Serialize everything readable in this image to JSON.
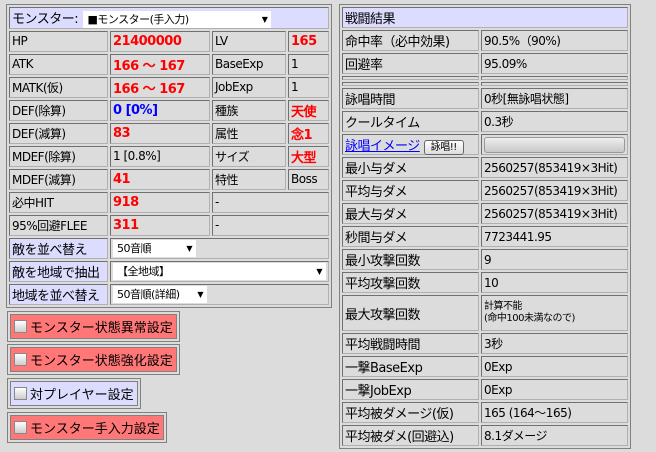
{
  "monster": {
    "label": "モンスター:",
    "selected": "■モンスター(手入力)"
  },
  "stats": [
    {
      "l1": "HP",
      "v1": "21400000",
      "c1": "red",
      "l2": "LV",
      "v2": "165",
      "c2": "red"
    },
    {
      "l1": "ATK",
      "v1": "166 ～ 167",
      "c1": "red",
      "l2": "BaseExp",
      "v2": "1",
      "c2": ""
    },
    {
      "l1": "MATK(仮)",
      "v1": "166 ～ 167",
      "c1": "red",
      "l2": "JobExp",
      "v2": "1",
      "c2": ""
    },
    {
      "l1": "DEF(除算)",
      "v1": "0 [0%]",
      "c1": "blue",
      "l2": "種族",
      "v2": "天使",
      "c2": "red"
    },
    {
      "l1": "DEF(減算)",
      "v1": "83",
      "c1": "red",
      "l2": "属性",
      "v2": "念1",
      "c2": "red"
    },
    {
      "l1": "MDEF(除算)",
      "v1": "1 [0.8%]",
      "c1": "",
      "l2": "サイズ",
      "v2": "大型",
      "c2": "red"
    },
    {
      "l1": "MDEF(減算)",
      "v1": "41",
      "c1": "red",
      "l2": "特性",
      "v2": "Boss",
      "c2": ""
    }
  ],
  "hit": {
    "label": "必中HIT",
    "value": "918",
    "extra": "-"
  },
  "flee": {
    "label": "95%回避FLEE",
    "value": "311",
    "extra": "-"
  },
  "sort_enemy": {
    "label": "敵を並べ替え",
    "selected": "50音順"
  },
  "filter_area": {
    "label": "敵を地域で抽出",
    "selected": "【全地域】"
  },
  "sort_area": {
    "label": "地域を並べ替え",
    "selected": "50音順(詳細)"
  },
  "settings": [
    "モンスター状態異常設定",
    "モンスター状態強化設定",
    "対プレイヤー設定",
    "モンスター手入力設定"
  ],
  "result": {
    "title": "戦闘結果",
    "rows1": [
      {
        "l": "命中率（必中効果)",
        "v": "90.5%（90%)"
      },
      {
        "l": "回避率",
        "v": "95.09%"
      }
    ],
    "rows2": [
      {
        "l": "詠唱時間",
        "v": "0秒[無詠唱状態]"
      },
      {
        "l": "クールタイム",
        "v": "0.3秒"
      }
    ],
    "chant_link": "詠唱イメージ",
    "chant_button": "詠唱!!",
    "rows3": [
      {
        "l": "最小与ダメ",
        "v": "2560257(853419×3Hit)"
      },
      {
        "l": "平均与ダメ",
        "v": "2560257(853419×3Hit)"
      },
      {
        "l": "最大与ダメ",
        "v": "2560257(853419×3Hit)"
      },
      {
        "l": "秒間与ダメ",
        "v": "7723441.95"
      },
      {
        "l": "最小攻撃回数",
        "v": "9"
      },
      {
        "l": "平均攻撃回数",
        "v": "10"
      }
    ],
    "max_attacks": {
      "l": "最大攻撃回数",
      "v1": "計算不能",
      "v2": "(命中100未満なので)"
    },
    "rows4": [
      {
        "l": "平均戦闘時間",
        "v": "3秒"
      },
      {
        "l": "一撃BaseExp",
        "v": "0Exp"
      },
      {
        "l": "一撃JobExp",
        "v": "0Exp"
      },
      {
        "l": "平均被ダメージ(仮)",
        "v": "165 (164～165)"
      },
      {
        "l": "平均被ダメ(回避込)",
        "v": "8.1ダメージ"
      }
    ]
  }
}
